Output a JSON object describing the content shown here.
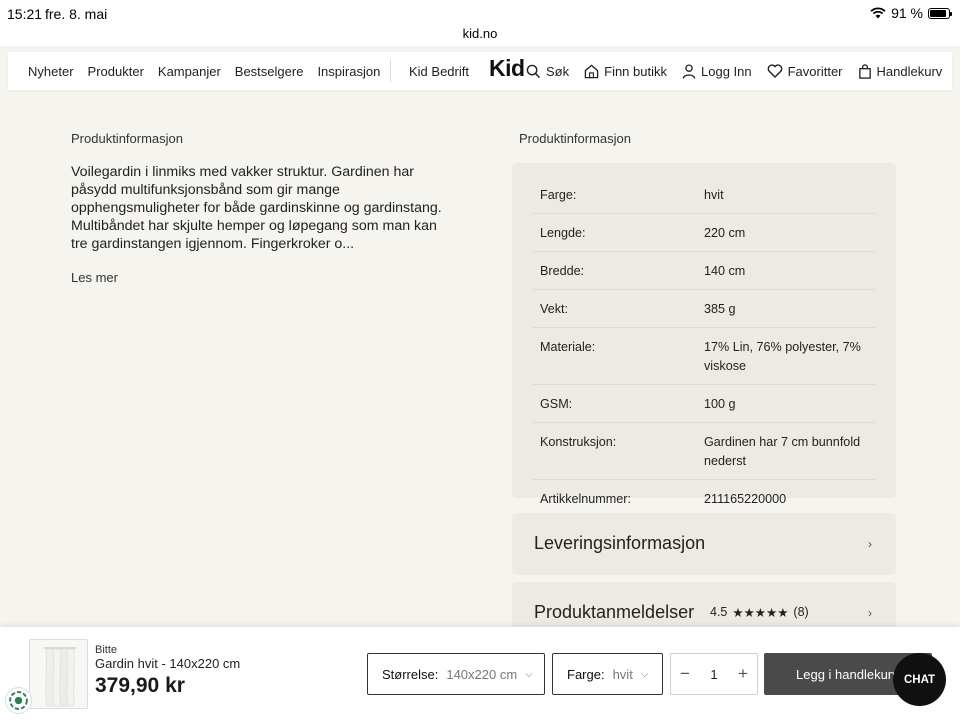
{
  "status_bar": {
    "time": "15:21",
    "date": "fre. 8. mai",
    "url": "kid.no",
    "battery": "91 %"
  },
  "nav": {
    "links": [
      "Nyheter",
      "Produkter",
      "Kampanjer",
      "Bestselgere",
      "Inspirasjon"
    ],
    "business": "Kid Bedrift",
    "logo": "Kid",
    "search": "Søk",
    "find_store": "Finn butikk",
    "login": "Logg Inn",
    "favorites": "Favoritter",
    "cart": "Handlekurv"
  },
  "description": {
    "title": "Produktinformasjon",
    "text": "Voilegardin i linmiks med vakker struktur. Gardinen har påsydd multifunksjonsbånd som gir mange opphengsmuligheter for både gardinskinne og gardinstang. Multibåndet har skjulte hemper og løpegang som man kan tre gardinstangen igjennom. Fingerkroker o...",
    "read_more": "Les mer"
  },
  "specs": {
    "title": "Produktinformasjon",
    "rows": [
      {
        "label": "Farge:",
        "value": "hvit"
      },
      {
        "label": "Lengde:",
        "value": "220 cm"
      },
      {
        "label": "Bredde:",
        "value": "140 cm"
      },
      {
        "label": "Vekt:",
        "value": "385 g"
      },
      {
        "label": "Materiale:",
        "value": "17% Lin, 76% polyester, 7% viskose"
      },
      {
        "label": "GSM:",
        "value": "100 g"
      },
      {
        "label": "Konstruksjon:",
        "value": "Gardinen har 7 cm bunnfold nederst"
      },
      {
        "label": "Artikkelnummer:",
        "value": "211165220000"
      }
    ]
  },
  "delivery": {
    "title": "Leveringsinformasjon"
  },
  "reviews": {
    "title": "Produktanmeldelser",
    "rating": "4.5",
    "stars": "★★★★★",
    "count": "(8)"
  },
  "bottom_bar": {
    "brand": "Bitte",
    "product_name": "Gardin hvit - 140x220 cm",
    "price": "379,90 kr",
    "size_label": "Størrelse:",
    "size_value": "140x220 cm",
    "color_label": "Farge:",
    "color_value": "hvit",
    "quantity": "1",
    "add_to_cart": "Legg i handlekurv",
    "chat": "CHAT"
  }
}
